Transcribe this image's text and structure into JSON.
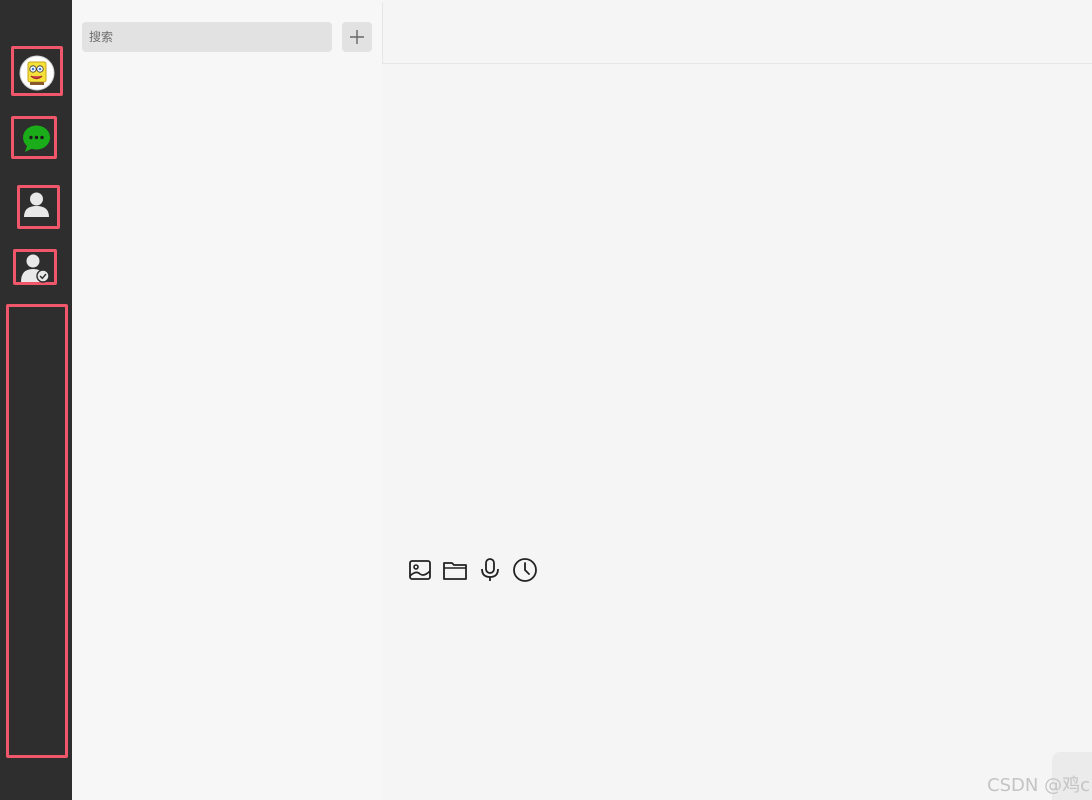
{
  "sidebar": {
    "items": [
      {
        "name": "avatar",
        "icon": "user-avatar-icon"
      },
      {
        "name": "chat",
        "icon": "chat-bubble-icon"
      },
      {
        "name": "contacts",
        "icon": "contact-person-icon"
      },
      {
        "name": "contact-management",
        "icon": "person-check-icon"
      }
    ],
    "highlight_color": "#f0576a",
    "background": "#2e2e2e"
  },
  "search": {
    "placeholder": "搜索",
    "add_icon": "plus-icon"
  },
  "toolbar": {
    "icons": [
      "image-icon",
      "folder-icon",
      "microphone-icon",
      "clock-icon"
    ]
  },
  "accent_color": "#1e86e0",
  "chat_green": "#1aad19",
  "watermark": "CSDN @鸡c"
}
